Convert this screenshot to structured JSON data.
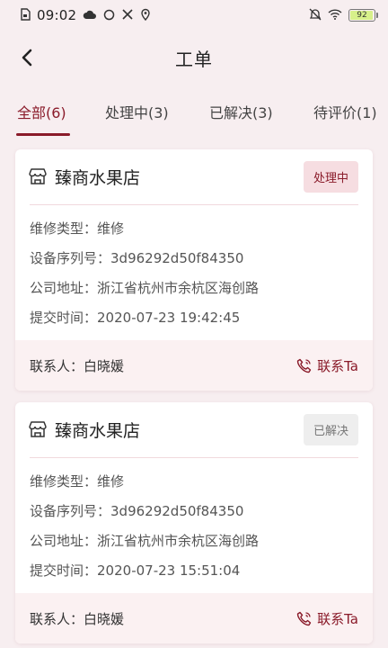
{
  "status_bar": {
    "time": "09:02",
    "battery": "92"
  },
  "nav": {
    "title": "工单"
  },
  "tabs": [
    {
      "label": "全部(6)"
    },
    {
      "label": "处理中(3)"
    },
    {
      "label": "已解决(3)"
    },
    {
      "label": "待评价(1)"
    }
  ],
  "cards": [
    {
      "shop": "臻商水果店",
      "status": "处理中",
      "fields": [
        {
          "label": "维修类型：",
          "value": "维修"
        },
        {
          "label": "设备序列号：",
          "value": "3d96292d50f84350"
        },
        {
          "label": "公司地址：",
          "value": "浙江省杭州市余杭区海创路"
        },
        {
          "label": "提交时间：",
          "value": "2020-07-23 19:42:45"
        }
      ],
      "contact_label": "联系人：",
      "contact_name": "白晓媛",
      "contact_button": "联系Ta"
    },
    {
      "shop": "臻商水果店",
      "status": "已解决",
      "fields": [
        {
          "label": "维修类型：",
          "value": "维修"
        },
        {
          "label": "设备序列号：",
          "value": "3d96292d50f84350"
        },
        {
          "label": "公司地址：",
          "value": "浙江省杭州市余杭区海创路"
        },
        {
          "label": "提交时间：",
          "value": "2020-07-23 15:51:04"
        }
      ],
      "contact_label": "联系人：",
      "contact_name": "白晓媛",
      "contact_button": "联系Ta"
    }
  ],
  "colors": {
    "accent": "#8a1b2a",
    "page_bg": "#f7eef0",
    "badge_processing_bg": "#f6dde1",
    "badge_resolved_bg": "#eeeeee"
  },
  "icons": [
    "sim-icon",
    "cloud-icon",
    "circle-icon",
    "tools-icon",
    "location-icon",
    "mute-icon",
    "wifi-icon",
    "battery-icon",
    "back-arrow-icon",
    "shop-icon",
    "phone-icon"
  ]
}
